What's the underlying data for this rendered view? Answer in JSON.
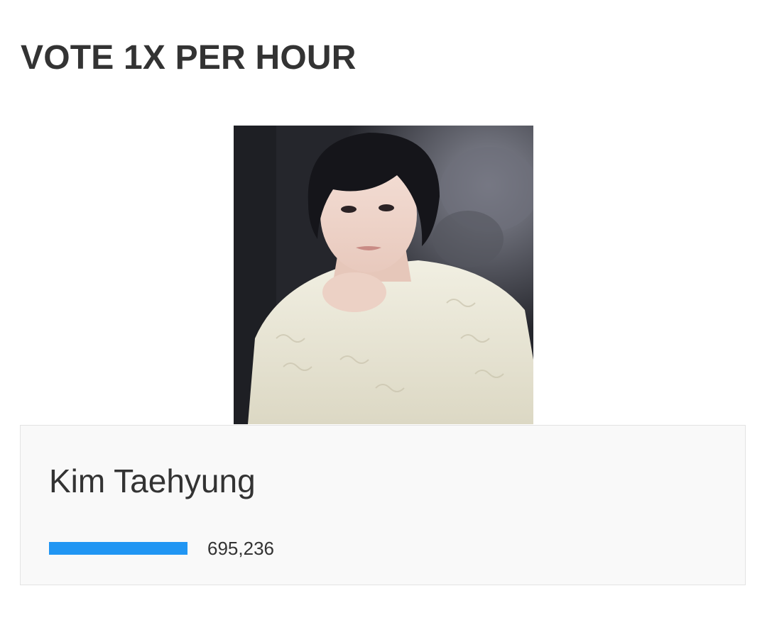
{
  "poll": {
    "heading": "VOTE 1X PER HOUR"
  },
  "candidate": {
    "name": "Kim Taehyung",
    "votes": "695,236",
    "bar_fill_fraction": 1.0,
    "bar_color": "#2196f3",
    "photo_alt": "Kim Taehyung"
  }
}
